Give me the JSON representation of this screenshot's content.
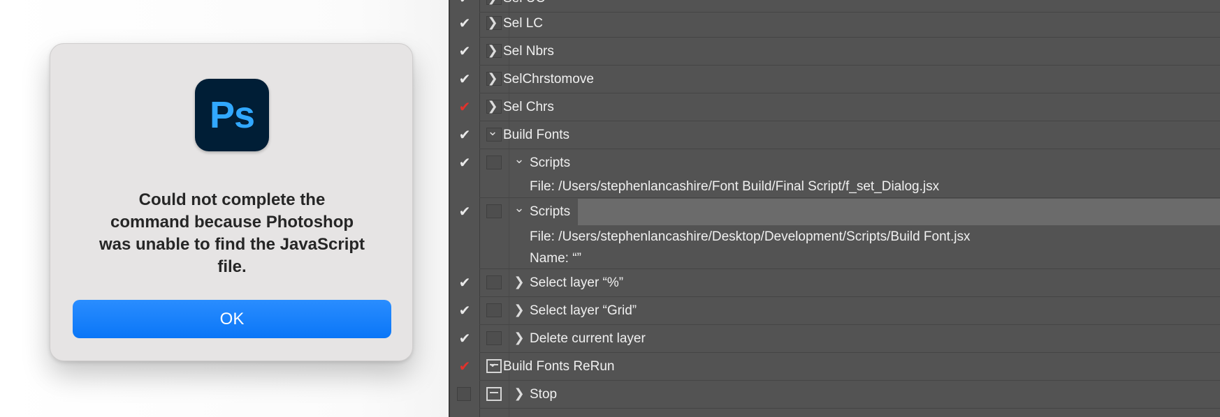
{
  "dialog": {
    "app_icon_text": "Ps",
    "message_line1": "Could not complete the",
    "message_line2": "command because Photoshop",
    "message_line3": "was unable to find the JavaScript",
    "message_line4": "file.",
    "ok_label": "OK",
    "accent_color": "#0a7aff",
    "icon_bg_color": "#001e36",
    "icon_text_color": "#31a8ff"
  },
  "actions_panel": {
    "check_glyph": "✔",
    "chevron_right": "❯",
    "chevron_down": "⌄",
    "rows": [
      {
        "label": "Sel UC"
      },
      {
        "label": "Sel LC"
      },
      {
        "label": "Sel Nbrs"
      },
      {
        "label": "SelChrstomove"
      },
      {
        "label": "Sel Chrs"
      },
      {
        "label": "Build Fonts"
      },
      {
        "label": "Scripts",
        "detail": "File: /Users/stephenlancashire/Font Build/Final Script/f_set_Dialog.jsx"
      },
      {
        "label": "Scripts",
        "detail": "File: /Users/stephenlancashire/Desktop/Development/Scripts/Build Font.jsx",
        "detail2": "Name:  “”"
      },
      {
        "label": "Select layer “%”"
      },
      {
        "label": "Select layer “Grid”"
      },
      {
        "label": "Delete current layer"
      },
      {
        "label": "Build Fonts ReRun"
      },
      {
        "label": "Stop"
      }
    ]
  }
}
